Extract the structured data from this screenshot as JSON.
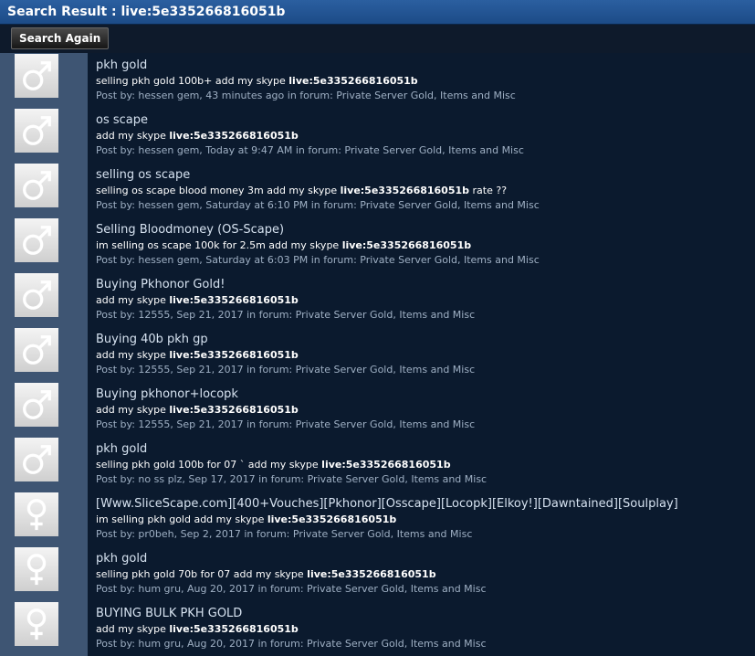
{
  "header": {
    "title": "Search Result : live:5e335266816051b"
  },
  "toolbar": {
    "search_again_label": "Search Again"
  },
  "results": [
    {
      "gender": "male",
      "title": "pkh gold",
      "snippet_pre": "selling pkh gold 100b+ add my skype ",
      "highlight": "live:5e335266816051b",
      "snippet_post": "",
      "meta": "Post by: hessen gem, 43 minutes ago in forum: Private Server Gold, Items and Misc"
    },
    {
      "gender": "male",
      "title": "os scape",
      "snippet_pre": "add my skype ",
      "highlight": "live:5e335266816051b",
      "snippet_post": "",
      "meta": "Post by: hessen gem, Today at 9:47 AM in forum: Private Server Gold, Items and Misc"
    },
    {
      "gender": "male",
      "title": "selling os scape",
      "snippet_pre": "selling os scape blood money 3m add my skype ",
      "highlight": "live:5e335266816051b",
      "snippet_post": " rate ??",
      "meta": "Post by: hessen gem, Saturday at 6:10 PM in forum: Private Server Gold, Items and Misc"
    },
    {
      "gender": "male",
      "title": "Selling Bloodmoney (OS-Scape)",
      "snippet_pre": "im selling os scape 100k for 2.5m add my skype ",
      "highlight": "live:5e335266816051b",
      "snippet_post": "",
      "meta": "Post by: hessen gem, Saturday at 6:03 PM in forum: Private Server Gold, Items and Misc"
    },
    {
      "gender": "male",
      "title": "Buying Pkhonor Gold!",
      "snippet_pre": "add my skype ",
      "highlight": "live:5e335266816051b",
      "snippet_post": "",
      "meta": "Post by: 12555, Sep 21, 2017 in forum: Private Server Gold, Items and Misc"
    },
    {
      "gender": "male",
      "title": "Buying 40b pkh gp",
      "snippet_pre": "add my skype ",
      "highlight": "live:5e335266816051b",
      "snippet_post": "",
      "meta": "Post by: 12555, Sep 21, 2017 in forum: Private Server Gold, Items and Misc"
    },
    {
      "gender": "male",
      "title": "Buying pkhonor+locopk",
      "snippet_pre": "add my skype ",
      "highlight": "live:5e335266816051b",
      "snippet_post": "",
      "meta": "Post by: 12555, Sep 21, 2017 in forum: Private Server Gold, Items and Misc"
    },
    {
      "gender": "male",
      "title": "pkh gold",
      "snippet_pre": "selling pkh gold 100b for 07 ` add my skype ",
      "highlight": "live:5e335266816051b",
      "snippet_post": "",
      "meta": "Post by: no ss plz, Sep 17, 2017 in forum: Private Server Gold, Items and Misc"
    },
    {
      "gender": "female",
      "title": "[Www.SliceScape.com][400+Vouches][Pkhonor][Osscape][Locopk][Elkoy!][Dawntained][Soulplay]",
      "snippet_pre": "im selling pkh gold add my skype ",
      "highlight": "live:5e335266816051b",
      "snippet_post": "",
      "meta": "Post by: pr0beh, Sep 2, 2017 in forum: Private Server Gold, Items and Misc"
    },
    {
      "gender": "female",
      "title": "pkh gold",
      "snippet_pre": "selling pkh gold 70b for 07 add my skype ",
      "highlight": "live:5e335266816051b",
      "snippet_post": "",
      "meta": "Post by: hum gru, Aug 20, 2017 in forum: Private Server Gold, Items and Misc"
    },
    {
      "gender": "female",
      "title": "BUYING BULK PKH GOLD",
      "snippet_pre": "add my skype ",
      "highlight": "live:5e335266816051b",
      "snippet_post": "",
      "meta": "Post by: hum gru, Aug 20, 2017 in forum: Private Server Gold, Items and Misc"
    }
  ]
}
